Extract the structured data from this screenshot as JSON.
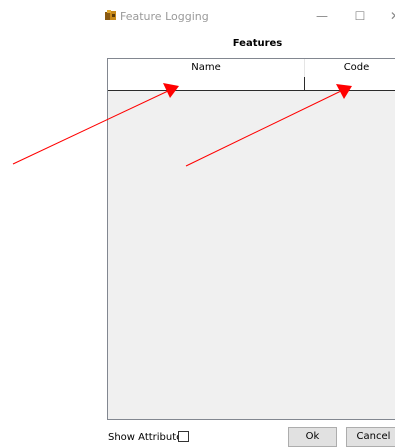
{
  "window": {
    "title": "Feature Logging",
    "icon": "app-icon",
    "minimize_glyph": "—",
    "maximize_glyph": "☐",
    "close_glyph": "✕"
  },
  "panel": {
    "title": "Features"
  },
  "grid": {
    "columns": [
      "Name",
      "Code"
    ],
    "rows": [
      [
        "",
        ""
      ]
    ]
  },
  "footer": {
    "show_attributes_label": "Show Attributes",
    "show_attributes_checked": false,
    "ok_label": "Ok",
    "cancel_label": "Cancel"
  },
  "annotations": {
    "arrow_color": "#ff0000"
  }
}
